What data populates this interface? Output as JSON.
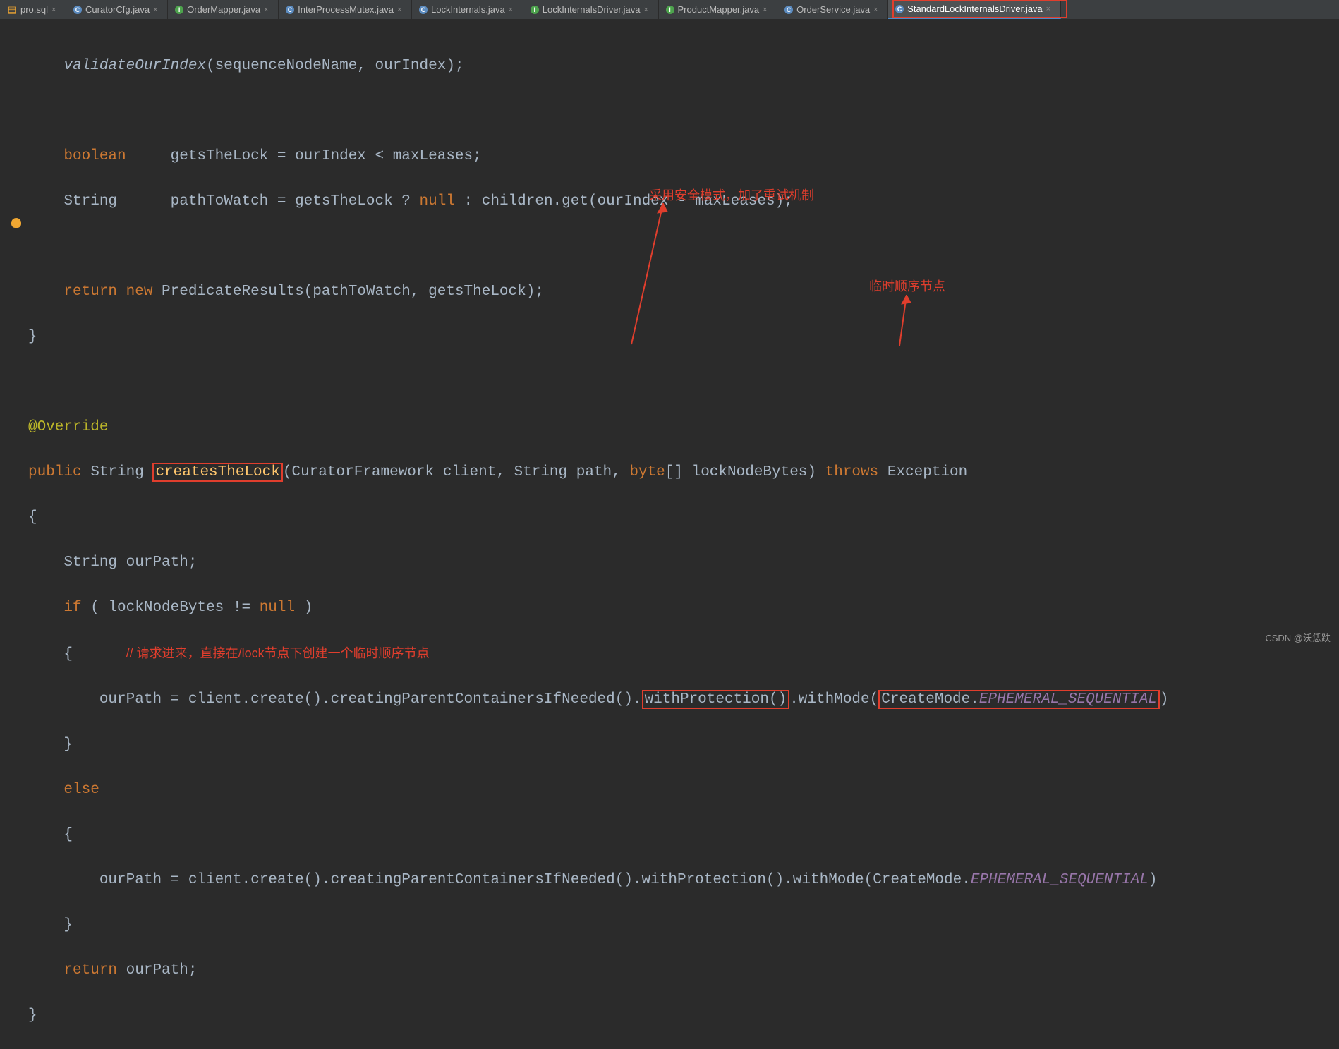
{
  "tabs": [
    {
      "label": "pro.sql",
      "type": "sql"
    },
    {
      "label": "CuratorCfg.java",
      "type": "class"
    },
    {
      "label": "OrderMapper.java",
      "type": "interface"
    },
    {
      "label": "InterProcessMutex.java",
      "type": "class"
    },
    {
      "label": "LockInternals.java",
      "type": "class"
    },
    {
      "label": "LockInternalsDriver.java",
      "type": "interface"
    },
    {
      "label": "ProductMapper.java",
      "type": "interface"
    },
    {
      "label": "OrderService.java",
      "type": "class"
    },
    {
      "label": "StandardLockInternalsDriver.java",
      "type": "class",
      "active": true
    }
  ],
  "code": {
    "l1a": "validateOurIndex",
    "l1b": "(sequenceNodeName, ourIndex);",
    "l2a": "boolean",
    "l2b": "     getsTheLock = ourIndex < maxLeases;",
    "l3a": "String      pathToWatch = getsTheLock ? ",
    "l3b": "null",
    "l3c": " : children.get(ourIndex - maxLeases);",
    "l4a": "return new ",
    "l4b": "PredicateResults(pathToWatch, getsTheLock);",
    "l5": "}",
    "ann": "@Override",
    "l6a": "public ",
    "l6b": "String ",
    "l6c": "createsTheLock",
    "l6d": "(CuratorFramework client, String path, ",
    "l6e": "byte",
    "l6f": "[] lockNodeBytes) ",
    "l6g": "throws ",
    "l6h": "Exception",
    "l7": "{",
    "l8": "String ourPath;",
    "l9a": "if",
    "l9b": " ( lockNodeBytes != ",
    "l9c": "null",
    "l9d": " )",
    "l10": "{",
    "l11a": "ourPath = client.create().creatingParentContainersIfNeeded().",
    "l11b": "withProtection()",
    "l11c": ".withMode(",
    "l11d": "CreateMode.",
    "l11e": "EPHEMERAL_SEQUENTIAL",
    "l11f": ")",
    "l12": "}",
    "l13": "else",
    "l14": "{",
    "l15a": "ourPath = client.create().creatingParentContainersIfNeeded().withProtection().withMode(CreateMode.",
    "l15b": "EPHEMERAL_SEQUENTIAL",
    "l15c": ")",
    "l16": "}",
    "l17a": "return ",
    "l17b": "ourPath;",
    "l18": "}"
  },
  "annotations": {
    "top": "采用安全模式，加了重试机制",
    "right": "临时顺序节点",
    "inline": "// 请求进来，直接在/lock节点下创建一个临时顺序节点"
  },
  "watermark": "CSDN @沃恁跌"
}
